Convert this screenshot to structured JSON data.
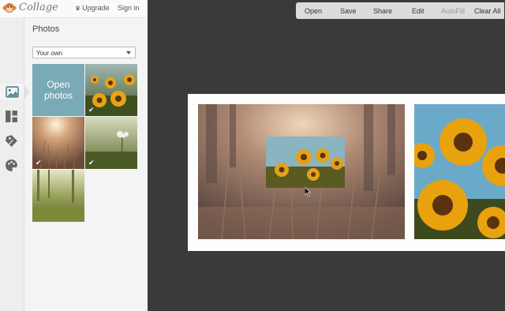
{
  "header": {
    "logo_text": "Collage",
    "upgrade_label": "Upgrade",
    "signin_label": "Sign in"
  },
  "rail": {
    "items": [
      {
        "icon": "image-icon",
        "active": true
      },
      {
        "icon": "layout-icon",
        "active": false
      },
      {
        "icon": "tag-icon",
        "active": false
      },
      {
        "icon": "palette-icon",
        "active": false
      }
    ]
  },
  "panel": {
    "title": "Photos",
    "source_select": "Your own",
    "open_photos_label": "Open photos",
    "thumbnails": [
      {
        "subject": "sunflowers",
        "used": true
      },
      {
        "subject": "sunlit grass",
        "used": true
      },
      {
        "subject": "meadow flowers",
        "used": true
      },
      {
        "subject": "forest grass",
        "used": false
      }
    ]
  },
  "toolbar": {
    "open_label": "Open",
    "save_label": "Save",
    "share_label": "Share",
    "edit_label": "Edit",
    "autofill_label": "AutoFill",
    "clearall_label": "Clear All"
  },
  "colors": {
    "accent": "#79aab6",
    "workspace_bg": "#3a3a3a",
    "panel_bg": "#f4f4f4",
    "toolbar_bg": "#dcdcdc"
  }
}
